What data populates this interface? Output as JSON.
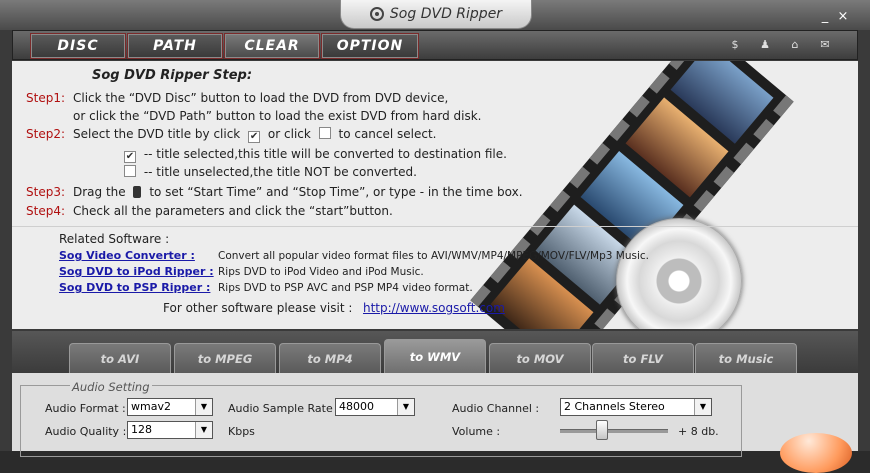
{
  "window": {
    "title": "Sog DVD Ripper",
    "minimize": "_",
    "close": "×"
  },
  "menu": [
    {
      "label": "DISC"
    },
    {
      "label": "PATH"
    },
    {
      "label": "CLEAR"
    },
    {
      "label": "OPTION"
    }
  ],
  "toolbar_icons": [
    "dollar-icon",
    "user-icon",
    "home-icon",
    "mail-icon"
  ],
  "toolbar_glyphs": {
    "dollar": "$",
    "user": "♟",
    "home": "⌂",
    "mail": "✉"
  },
  "steps": {
    "header": "Sog DVD Ripper Step:",
    "step1_label": "Step1:",
    "step1_line1": "Click the “DVD Disc” button to load the DVD from DVD device,",
    "step1_line2": "or click the “DVD Path” button to load the exist DVD from hard disk.",
    "step2_label": "Step2:",
    "step2_pre": "Select the DVD title by click",
    "step2_mid": "or click",
    "step2_post": "to cancel select.",
    "step2_sel": "-- title selected,this title will be converted to destination file.",
    "step2_unsel": "-- title unselected,the title NOT be converted.",
    "step3_label": "Step3:",
    "step3_pre": "Drag the",
    "step3_post": "to set “Start Time” and “Stop Time”, or type - in the time box.",
    "step4_label": "Step4:",
    "step4_text": "Check all the parameters and click the “start”button."
  },
  "related": {
    "title": "Related Software :",
    "items": [
      {
        "name": "Sog Video Converter :",
        "desc": "Convert all popular video format files to AVI/WMV/MP4/MPEG/MOV/FLV/Mp3 Music."
      },
      {
        "name": "Sog DVD to iPod Ripper :",
        "desc": "Rips DVD to iPod Video and iPod Music."
      },
      {
        "name": "Sog DVD to PSP Ripper :",
        "desc": "Rips DVD to PSP AVC and PSP MP4 video format."
      }
    ],
    "visit_label": "For other software please visit :",
    "visit_url": "http://www.sogsoft.com"
  },
  "tabs": [
    {
      "label": "to AVI"
    },
    {
      "label": "to MPEG"
    },
    {
      "label": "to MP4"
    },
    {
      "label": "to WMV",
      "active": true
    },
    {
      "label": "to MOV"
    },
    {
      "label": "to FLV"
    },
    {
      "label": "to Music"
    }
  ],
  "audio": {
    "group_title": "Audio Setting",
    "format_label": "Audio Format :",
    "format_value": "wmav2",
    "sample_rate_label": "Audio Sample Rate :",
    "sample_rate_value": "48000",
    "channel_label": "Audio Channel :",
    "channel_value": "2 Channels Stereo",
    "quality_label": "Audio Quality :",
    "quality_value": "128",
    "quality_unit": "Kbps",
    "volume_label": "Volume :",
    "volume_value": "+ 8 db."
  },
  "colors": {
    "step_label": "#b01010",
    "link": "#1a1aa8",
    "window_bg": "#3a3a3a"
  }
}
